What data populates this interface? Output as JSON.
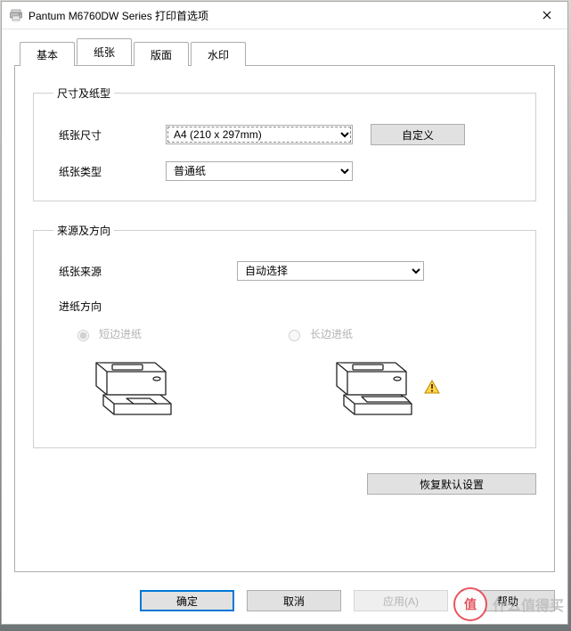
{
  "window": {
    "title": "Pantum M6760DW Series 打印首选项"
  },
  "tabs": {
    "basic": "基本",
    "paper": "纸张",
    "layout": "版面",
    "watermark": "水印"
  },
  "sizeType": {
    "legend": "尺寸及纸型",
    "sizeLabel": "纸张尺寸",
    "sizeValue": "A4 (210 x 297mm)",
    "customBtn": "自定义",
    "typeLabel": "纸张类型",
    "typeValue": "普通纸"
  },
  "srcOrient": {
    "legend": "来源及方向",
    "sourceLabel": "纸张来源",
    "sourceValue": "自动选择",
    "feedLabel": "进纸方向",
    "shortEdge": "短边进纸",
    "longEdge": "长边进纸"
  },
  "restoreDefaults": "恢复默认设置",
  "footer": {
    "ok": "确定",
    "cancel": "取消",
    "apply": "应用(A)",
    "help": "帮助"
  },
  "watermark": {
    "badge": "值",
    "text": "什么值得买"
  }
}
